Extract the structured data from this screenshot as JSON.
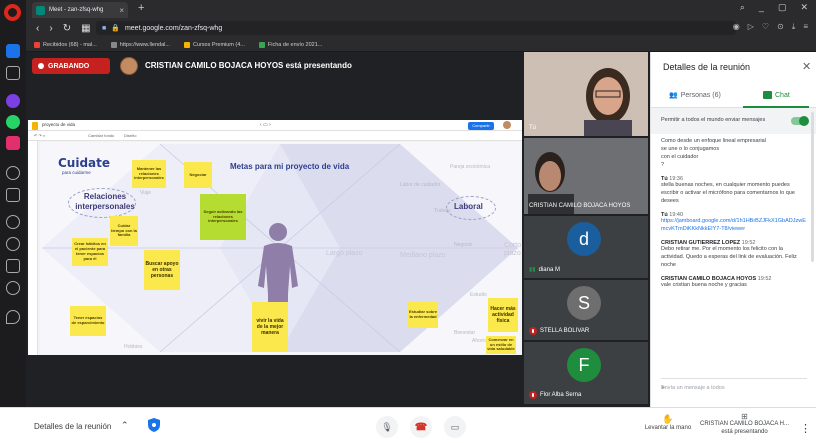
{
  "browser": {
    "tab_title": "Meet - zan-zfsq-whg",
    "url": "meet.google.com/zan-zfsq-whg",
    "bookmarks": [
      "Recibidos (68) - mal...",
      "https://www.llendal...",
      "Cursos Premium (4...",
      "Ficha de envío 2021..."
    ]
  },
  "meet": {
    "recording_label": "GRABANDO",
    "presenter_text": "CRISTIAN CAMILO BOJACA HOYOS está presentando",
    "presenter_avatar_icon": "user-avatar-icon"
  },
  "slides": {
    "doc_title": "proyecto de vida",
    "share_label": "Compartir",
    "toolbar": [
      "Cambiar fondo",
      "Diseño"
    ],
    "slide_title": "Metas para mi proyecto de vida",
    "logo_main": "Cuidate",
    "logo_sub": "para cuidarme",
    "areas": {
      "relaciones": "Relaciones interpersonales",
      "laboral": "Laboral"
    },
    "faint_labels": [
      "Pareja económica",
      "Labor de cuidador",
      "Trabajo",
      "Negocio",
      "Estudio",
      "Viaje",
      "Hobbies",
      "Ahorro y Inversión",
      "Bienestar"
    ],
    "horizons": [
      "Largo plazo",
      "Mediano plazo",
      "Corto plazo"
    ],
    "stickies": {
      "s1": "Mantener las relaciones interpersonales",
      "s2": "Negociar",
      "s3": "Seguir activando las relaciones interpersonales",
      "s4": "Cuidar tiempo con la familia",
      "s5": "Crear hábitos en el paciente para tener espacios para él",
      "s6": "Buscar apoyo en otras personas",
      "s7": "vivir la vida de la mejor manera",
      "s8": "Tener espacios de esparcimiento",
      "s9": "Estudiar sobre la enfermedad",
      "s10": "Hacer más actividad física",
      "s11": "Comenzar en un estilo de vida saludable"
    }
  },
  "tiles": [
    {
      "name": "Tú",
      "muted": false
    },
    {
      "name": "CRISTIAN CAMILO BOJACA HOYOS",
      "muted": false
    },
    {
      "name": "diana M",
      "initial": "d",
      "color": "#1a5e9e",
      "muted": false
    },
    {
      "name": "STELLA BOLIVAR",
      "initial": "S",
      "color": "#6e6e6e",
      "muted": true
    },
    {
      "name": "Flor Alba Serna",
      "initial": "F",
      "color": "#1e8e3e",
      "muted": true
    }
  ],
  "panel": {
    "title": "Detalles de la reunión",
    "people_tab": "Personas (6)",
    "chat_tab": "Chat",
    "allow_label": "Permitir a todos el mundo enviar mensajes",
    "allow_on": true,
    "messages": [
      {
        "lines": [
          "Como desde un enfoque lineal empresarial",
          "se une o lo conjugamos",
          "con el cuidador",
          "?"
        ]
      },
      {
        "sender": "Tú",
        "time": "19:36",
        "lines": [
          "stella buenas noches, en cualquier momento puedes escribir o activar el micrófono para comentarnos lo que desees"
        ]
      },
      {
        "sender": "Tú",
        "time": "19:40",
        "link": "https://jamboard.google.com/d/1h1HBrBZJFkX1GbADJzwEmcvKTmDiKKkNkkEIY7-T8/viewer"
      },
      {
        "sender": "CRISTIAN GUTIERREZ LOPEZ",
        "time": "19:52",
        "lines": [
          "Debo retirar me. Por el momento los felicito con la actividad. Quedo a esperas del link de evaluación. Feliz noche"
        ]
      },
      {
        "sender": "CRISTIAN CAMILO BOJACA HOYOS",
        "time": "19:52",
        "lines": [
          "vale cristian buena noche y gracias"
        ]
      }
    ],
    "input_placeholder": "Envía un mensaje a todos"
  },
  "bottom": {
    "details_label": "Detalles de la reunión",
    "raise_hand_label": "Levantar la mano",
    "present_name": "CRISTIAN CAMILO BOJACA H...",
    "present_status": "está presentando"
  },
  "colors": {
    "record": "#c5221f",
    "chat_accent": "#1e8e3e",
    "hangup": "#d93025",
    "sticky": "#fbe84d"
  }
}
